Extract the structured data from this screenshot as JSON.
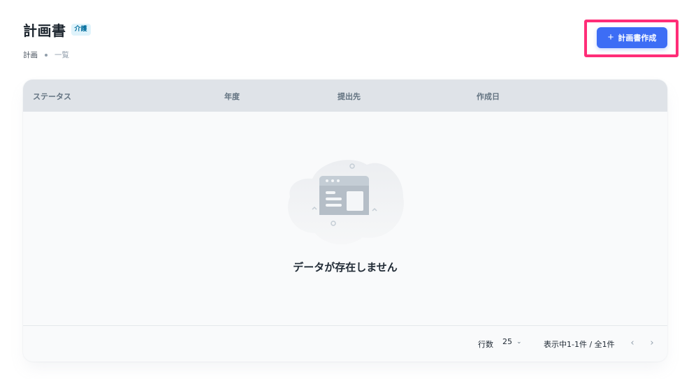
{
  "header": {
    "title": "計画書",
    "badge": "介護",
    "breadcrumb": [
      "計画",
      "一覧"
    ]
  },
  "toolbar": {
    "create_label": "計画書作成",
    "create_icon": "plus-icon"
  },
  "table": {
    "columns": [
      "ステータス",
      "年度",
      "提出先",
      "作成日"
    ],
    "rows": [],
    "empty_text": "データが存在しません"
  },
  "pagination": {
    "rows_label": "行数",
    "rows_per_page": "25",
    "range_text": "表示中1-1件 / 全1件"
  },
  "colors": {
    "accent": "#3d6df5",
    "highlight": "#ff2d78",
    "header_bg": "#dfe3e8"
  }
}
